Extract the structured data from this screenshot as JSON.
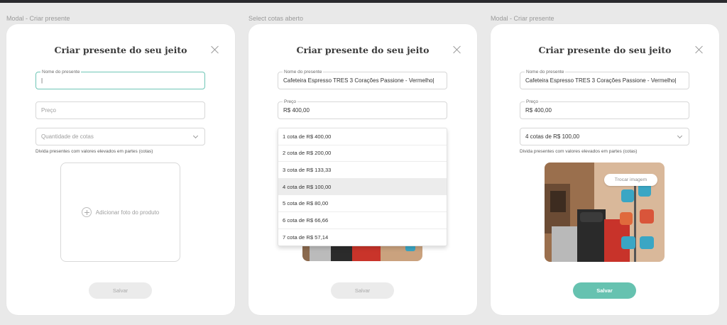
{
  "frames": [
    {
      "label": "Modal - Criar presente",
      "title": "Criar presente do seu jeito",
      "name_label": "Nome do presente",
      "name_value": "|",
      "price_placeholder": "Preço",
      "quotas_placeholder": "Quantidade de cotas",
      "helper": "Divida presentes com valores elevados em partes (cotas)",
      "upload_label": "Adicionar foto do produto",
      "save_label": "Salvar"
    },
    {
      "label": "Select cotas aberto",
      "title": "Criar presente do seu jeito",
      "name_label": "Nome do presente",
      "name_value": "Cafeteira Espresso TRES 3 Corações Passione - Vermelho|",
      "price_label": "Preço",
      "price_value": "R$ 400,00",
      "options": [
        "1 cota de R$ 400,00",
        "2 cota de R$ 200,00",
        "3 cota de R$ 133,33",
        "4 cota de R$ 100,00",
        "5 cota de R$ 80,00",
        "6 cota de R$ 66,66",
        "7 cota de R$ 57,14"
      ],
      "selected_option_index": 3,
      "save_label": "Salvar"
    },
    {
      "label": "Modal - Criar presente",
      "title": "Criar presente do seu jeito",
      "name_label": "Nome do presente",
      "name_value": "Cafeteira Espresso TRES 3 Corações Passione - Vermelho|",
      "price_label": "Preço",
      "price_value": "R$ 400,00",
      "quotas_value": "4 cotas de R$ 100,00",
      "helper": "Divida presentes com valores elevados em partes (cotas)",
      "swap_image_label": "Trocar imagem",
      "save_label": "Salvar"
    }
  ],
  "colors": {
    "accent": "#66c2b0",
    "focus_border": "#6fc6b6",
    "background": "#e9e9e9"
  }
}
